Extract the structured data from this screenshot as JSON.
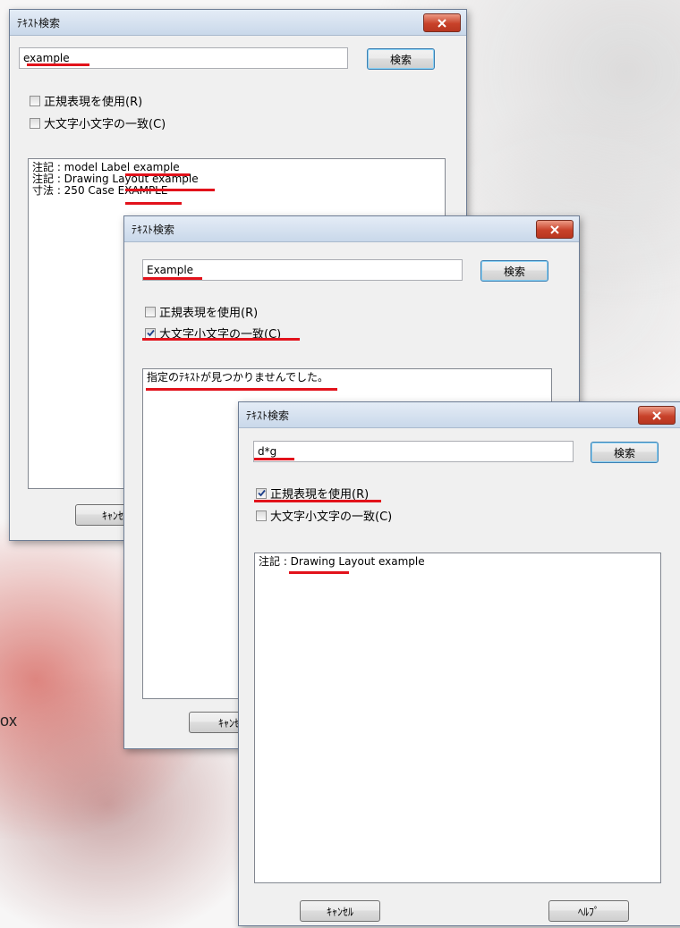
{
  "background_text": "ox",
  "accent_color": "#e2121b",
  "dialogs": [
    {
      "title": "ﾃｷｽﾄ検索",
      "search_value": "example",
      "search_button": "検索",
      "regex_label": "正規表現を使用(R)",
      "regex_checked": false,
      "case_label": "大文字小文字の一致(C)",
      "case_checked": false,
      "results": [
        "注記 : model Label example",
        "注記 : Drawing Layout example",
        "寸法 :  250 Case EXAMPLE"
      ],
      "cancel_button": "ｷｬﾝｾﾙ"
    },
    {
      "title": "ﾃｷｽﾄ検索",
      "search_value": "Example",
      "search_button": "検索",
      "regex_label": "正規表現を使用(R)",
      "regex_checked": false,
      "case_label": "大文字小文字の一致(C)",
      "case_checked": true,
      "results": [
        "指定のﾃｷｽﾄが見つかりませんでした。"
      ],
      "cancel_button": "ｷｬﾝｾ"
    },
    {
      "title": "ﾃｷｽﾄ検索",
      "search_value": "d*g",
      "search_button": "検索",
      "regex_label": "正規表現を使用(R)",
      "regex_checked": true,
      "case_label": "大文字小文字の一致(C)",
      "case_checked": false,
      "results": [
        "注記 : Drawing Layout example"
      ],
      "cancel_button": "ｷｬﾝｾﾙ",
      "help_button": "ﾍﾙﾌﾟ"
    }
  ]
}
